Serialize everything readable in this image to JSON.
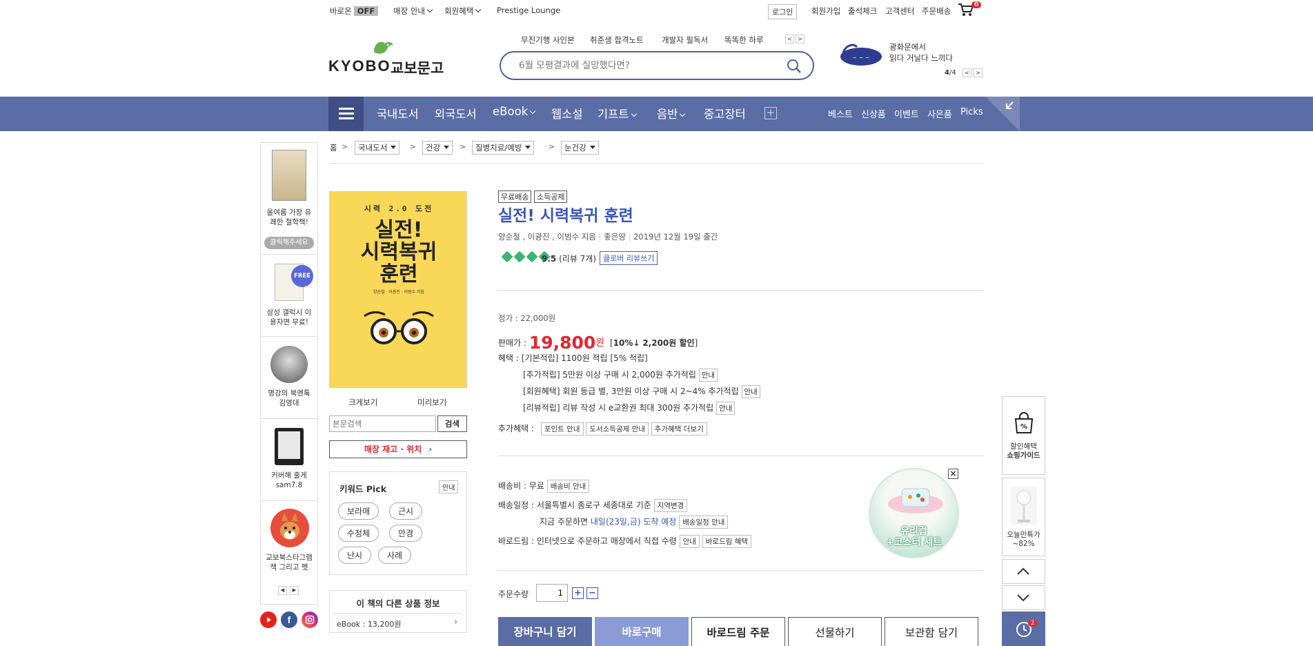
{
  "topbar": {
    "baro_label": "바로온",
    "baro_state": "OFF",
    "store_info": "매장 안내",
    "member_benefit": "회원혜택",
    "prestige": "Prestige Lounge",
    "login": "로그인",
    "join": "회원가입",
    "attendance": "출석체크",
    "customer_center": "고객센터",
    "order_delivery": "주문배송",
    "cart_count": "0"
  },
  "header": {
    "logo_text_en": "KYOBO",
    "logo_text_ko": "교보문고",
    "quick_links": [
      "무진기행 사인본",
      "취준생 합격노트",
      "개발자 필독서",
      "똑똑한 하루"
    ],
    "search_placeholder": "6월 모평결과에 실망했다면?",
    "promo_line1": "광화문에서",
    "promo_line2": "읽다 거닐다 느끼다",
    "promo_page_current": "4",
    "promo_page_total": "/4"
  },
  "nav": {
    "items": [
      "국내도서",
      "외국도서",
      "eBook",
      "웹소설",
      "기프트",
      "음반",
      "중고장터"
    ],
    "sub_items": [
      "베스트",
      "신상품",
      "이벤트",
      "사은품",
      "Picks"
    ]
  },
  "breadcrumb": {
    "home": "홈",
    "levels": [
      "국내도서",
      "건강",
      "질병치료/예방",
      "눈건강"
    ]
  },
  "left_sidebar": {
    "cards": [
      {
        "label": "올여름 가장 유쾌한 철학책!",
        "button": "클릭해주세요"
      },
      {
        "label": "삼성 갤럭시 이용자면 무료!",
        "badge": "FREE"
      },
      {
        "label": "명강의 북멘톡 김영대"
      },
      {
        "label": "커버해 줄게 sam7.8"
      },
      {
        "label": "교보북스타그램 책 그리고 펫"
      }
    ]
  },
  "book_cover": {
    "top_line": "시력 2.0 도전",
    "title_line1": "실전!",
    "title_line2": "시력복귀",
    "title_line3": "훈련",
    "authors": "양순철 · 이광진 · 이범수 지음"
  },
  "preview": {
    "zoom": "크게보기",
    "preview": "미리보기",
    "body_search_placeholder": "본문검색",
    "search_btn": "검색",
    "stock_btn": "매장 재고 · 위치"
  },
  "keyword_pick": {
    "title": "키워드 Pick",
    "info": "안내",
    "keywords": [
      "보라매",
      "근시",
      "수정체",
      "안경",
      "난시",
      "사례"
    ]
  },
  "other_product": {
    "title": "이 책의 다른 상품 정보",
    "ebook": "eBook : 13,200원"
  },
  "product": {
    "tags": [
      "무료배송",
      "소득공제"
    ],
    "title": "실전! 시력복귀 훈련",
    "authors": "양순철 , 이광진 , 이범수 지음",
    "publisher": "좋은땅",
    "pub_date": "2019년 12월 19일 출간",
    "rating": "9.5",
    "review_count": "(리뷰 7개)",
    "review_btn": "클로버 리뷰쓰기",
    "list_price": "정가 : 22,000원",
    "sale_label": "판매가 :",
    "sale_price": "19,800",
    "won": "원",
    "discount_pct": "10%↓",
    "discount_amt": "2,200원 할인",
    "benefit_label": "혜택 :",
    "benefit_basic": "[기본적립] 1100원 적립 [5% 적립]",
    "benefit_extra": "[추가적립] 5만원 이상 구매 시 2,000원 추가적립",
    "benefit_member": "[회원혜택] 회원 등급 별, 3만원 이상 구매 시 2~4% 추가적립",
    "benefit_review": "[리뷰적립] 리뷰 작성 시 e교환권 최대 300원 추가적립",
    "guide": "안내",
    "extra_benefit_label": "추가혜택 :",
    "extra_benefits": [
      "포인트 안내",
      "도서소득공제 안내",
      "추가혜택 더보기"
    ]
  },
  "delivery": {
    "fee": "배송비 : 무료",
    "fee_btn": "배송비 안내",
    "schedule": "배송일정 : 서울특별시 종로구 세종대로 기준",
    "region_btn": "지역변경",
    "schedule_now": "지금 주문하면",
    "schedule_date": "내일(23일,금) 도착 예정",
    "schedule_btn": "배송일정 안내",
    "barodrim": "바로드림 : 인터넷으로 주문하고 매장에서 직접 수령",
    "barodrim_btn1": "안내",
    "barodrim_btn2": "바로드림 혜택"
  },
  "promo_circle": {
    "line1": "유리컵",
    "line2": "+코스터 세트"
  },
  "order": {
    "qty_label": "주문수량",
    "qty_value": "1",
    "cart": "장바구니 담기",
    "buy_now": "바로구매",
    "barodrim": "바로드림 주문",
    "gift": "선물하기",
    "wishlist": "보관함 담기"
  },
  "right_widgets": {
    "shopping_guide_line1": "할인혜택",
    "shopping_guide_line2": "쇼핑가이드",
    "today_deal_line1": "오늘만특가",
    "today_deal_line2": "~82%",
    "recent_count": "2"
  },
  "colors": {
    "nav_bg": "#5b6da5",
    "price_red": "#e3262d",
    "title_blue": "#3a55b4",
    "cart_btn": "#5b6da5",
    "buy_btn": "#8a9bd6"
  }
}
